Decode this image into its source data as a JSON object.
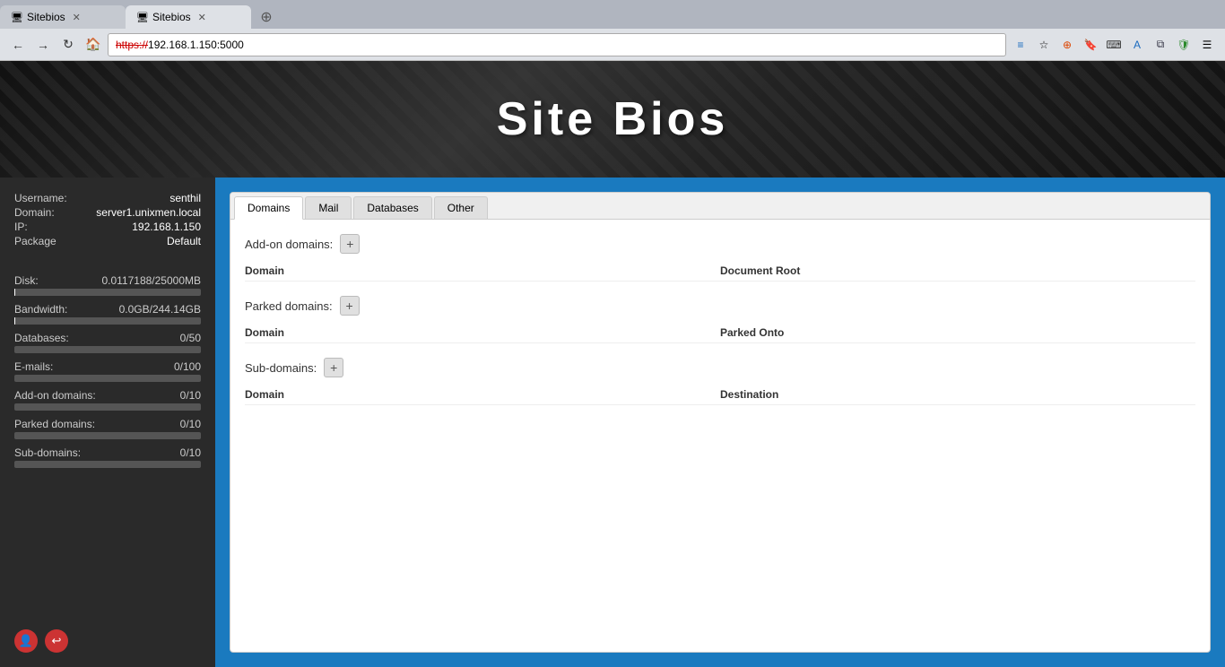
{
  "browser": {
    "tabs": [
      {
        "id": 1,
        "label": "Sitebios",
        "active": false
      },
      {
        "id": 2,
        "label": "Sitebios",
        "active": true
      }
    ],
    "address": {
      "protocol": "https://",
      "host": "192.168.1.150",
      "port": ":5000"
    }
  },
  "header": {
    "title": "Site  Bios"
  },
  "sidebar": {
    "username_label": "Username:",
    "username_value": "senthil",
    "domain_label": "Domain:",
    "domain_value": "server1.unixmen.local",
    "ip_label": "IP:",
    "ip_value": "192.168.1.150",
    "package_label": "Package",
    "package_value": "Default",
    "disk_label": "Disk:",
    "disk_value": "0.0117188/25000MB",
    "disk_percent": 0.05,
    "bandwidth_label": "Bandwidth:",
    "bandwidth_value": "0.0GB/244.14GB",
    "bandwidth_percent": 0.05,
    "databases_label": "Databases:",
    "databases_value": "0/50",
    "databases_percent": 0,
    "emails_label": "E-mails:",
    "emails_value": "0/100",
    "emails_percent": 0,
    "addon_label": "Add-on domains:",
    "addon_value": "0/10",
    "addon_percent": 0,
    "parked_label": "Parked domains:",
    "parked_value": "0/10",
    "parked_percent": 0,
    "subdomains_label": "Sub-domains:",
    "subdomains_value": "0/10",
    "subdomains_percent": 0
  },
  "tabs": {
    "domains_label": "Domains",
    "mail_label": "Mail",
    "databases_label": "Databases",
    "other_label": "Other"
  },
  "domains": {
    "addon_section_label": "Add-on domains:",
    "addon_add_btn": "+",
    "addon_col1": "Domain",
    "addon_col2": "Document Root",
    "parked_section_label": "Parked domains:",
    "parked_add_btn": "+",
    "parked_col1": "Domain",
    "parked_col2": "Parked Onto",
    "sub_section_label": "Sub-domains:",
    "sub_add_btn": "+",
    "sub_col1": "Domain",
    "sub_col2": "Destination"
  }
}
